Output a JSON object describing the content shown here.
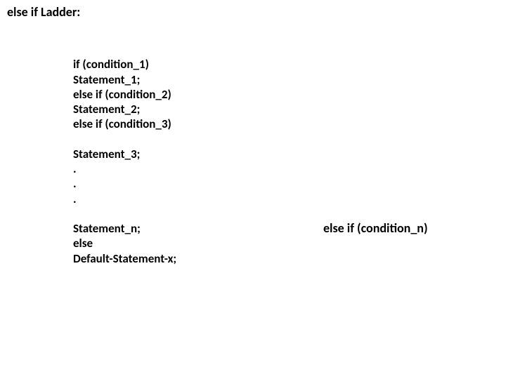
{
  "title": "else if Ladder:",
  "code": {
    "l1": "if (condition_1)",
    "l2": "Statement_1;",
    "l3": "else if (condition_2)",
    "l4": "Statement_2;",
    "l5": "else if (condition_3)",
    "blank1": "",
    "l6": "Statement_3;",
    "l7": ".",
    "l8": ".",
    "l9": ".",
    "blank2": "",
    "l10": "Statement_n;",
    "l11": "else",
    "l12": "Default-Statement-x;"
  },
  "annotation": "else if (condition_n)"
}
